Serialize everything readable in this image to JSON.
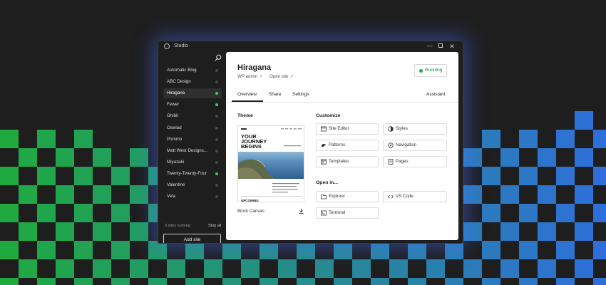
{
  "window": {
    "title": "Studio",
    "controls": {
      "minimize": "—",
      "maximize": "",
      "close": "✕"
    }
  },
  "sidebar": {
    "sites": [
      {
        "name": "Automatic Blog",
        "running": false,
        "active": false
      },
      {
        "name": "ABC Design",
        "running": false,
        "active": false
      },
      {
        "name": "Hiragana",
        "running": true,
        "active": true
      },
      {
        "name": "Fewer",
        "running": true,
        "active": false
      },
      {
        "name": "Ghibli",
        "running": false,
        "active": false
      },
      {
        "name": "Oswiad",
        "running": false,
        "active": false
      },
      {
        "name": "Pommo",
        "running": false,
        "active": false
      },
      {
        "name": "Matt West Designs...",
        "running": false,
        "active": false
      },
      {
        "name": "Miyazaki",
        "running": false,
        "active": false
      },
      {
        "name": "Twenty-Twenty-Four",
        "running": true,
        "active": false
      },
      {
        "name": "Valentine",
        "running": false,
        "active": false
      },
      {
        "name": "Vela",
        "running": false,
        "active": false
      }
    ],
    "running_count": "3 sites running",
    "stop_all": "Stop all",
    "add_site": "Add site"
  },
  "site": {
    "title": "Hiragana",
    "links": {
      "wp_admin": "WP admin",
      "open_site": "Open site",
      "external_glyph": "↗"
    },
    "status": "Running",
    "tabs": [
      "Overview",
      "Share",
      "Settings"
    ],
    "assistant_tab": "Assistant",
    "theme": {
      "heading": "Theme",
      "name": "Block Canvas",
      "preview": {
        "hero_text": "YOUR JOURNEY BEGINS",
        "footer_text": "UPCOMING"
      }
    },
    "customize": {
      "heading": "Customize",
      "actions": [
        {
          "label": "Site Editor",
          "icon": "site-editor-icon"
        },
        {
          "label": "Styles",
          "icon": "styles-icon"
        },
        {
          "label": "Patterns",
          "icon": "patterns-icon"
        },
        {
          "label": "Navigation",
          "icon": "navigation-icon"
        },
        {
          "label": "Templates",
          "icon": "templates-icon"
        },
        {
          "label": "Pages",
          "icon": "pages-icon"
        }
      ]
    },
    "open_in": {
      "heading": "Open in...",
      "actions": [
        {
          "label": "Explorer",
          "icon": "folder-icon"
        },
        {
          "label": "VS Code",
          "icon": "code-icon"
        },
        {
          "label": "Terminal",
          "icon": "terminal-icon"
        }
      ]
    }
  },
  "colors": {
    "background": "#1e1e1e",
    "running_green": "#1fae45",
    "checker_green": "#1f9a3e",
    "checker_blue": "#2f6fd6"
  }
}
